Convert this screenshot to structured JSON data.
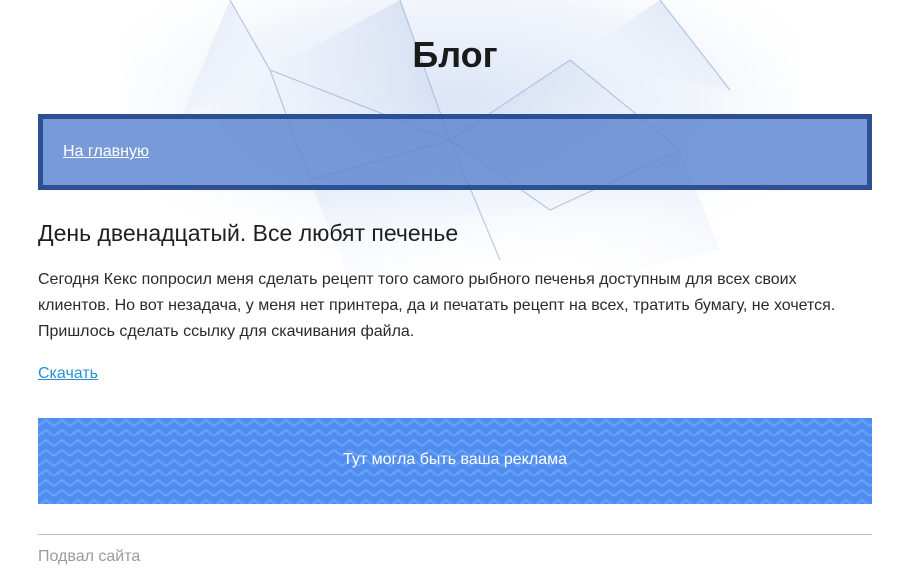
{
  "header": {
    "title": "Блог"
  },
  "nav": {
    "home_link": "На главную"
  },
  "post": {
    "title": "День двенадцатый. Все любят печенье",
    "text": "Сегодня Кекс попросил меня сделать рецепт того самого рыбного печенья доступным для всех своих клиентов. Но вот незадача, у меня нет принтера, да и печатать рецепт на всех, тратить бумагу, не хочется. Пришлось сделать ссылку для скачивания файла.",
    "download_link": "Скачать"
  },
  "ad": {
    "text": "Тут могла быть ваша реклама"
  },
  "footer": {
    "text": "Подвал сайта"
  },
  "colors": {
    "nav_border": "#2d4f93",
    "nav_background": "#5c84cf",
    "link": "#2a8fd0",
    "ad_background": "#4f8ef0"
  }
}
